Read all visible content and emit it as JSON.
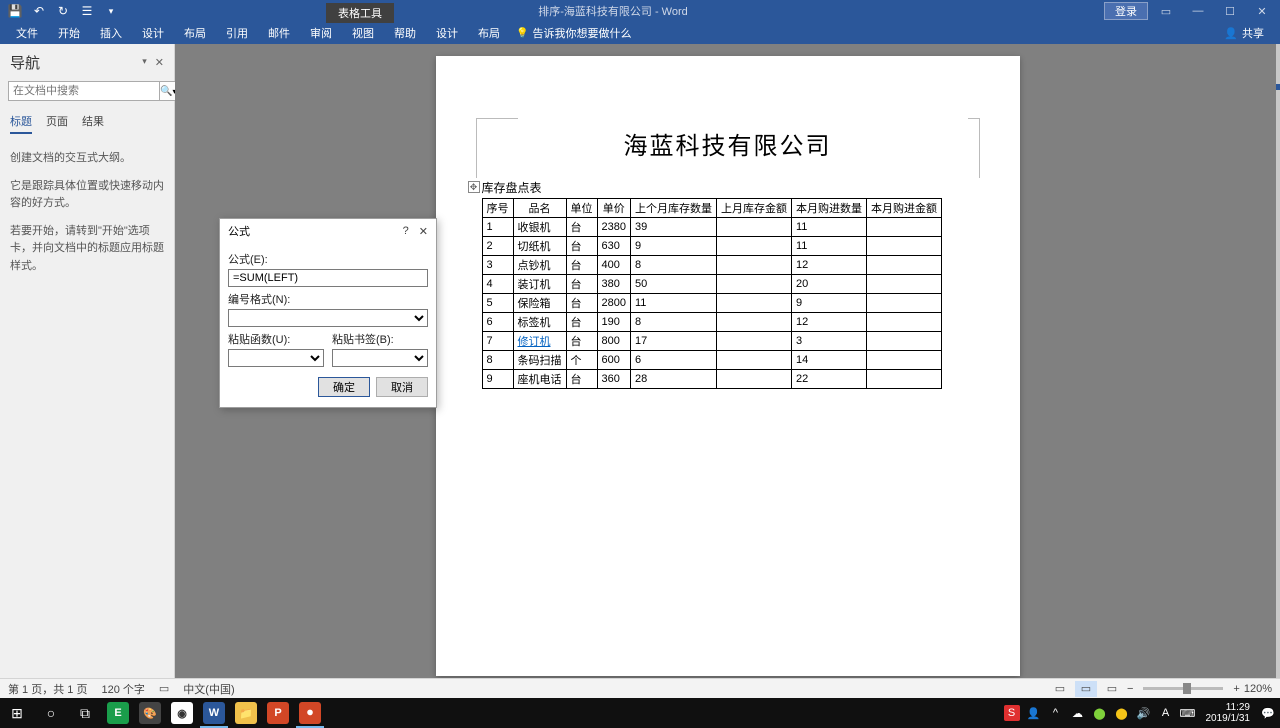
{
  "titlebar": {
    "context_tab": "表格工具",
    "doc_title": "排序-海蓝科技有限公司 - Word",
    "login": "登录"
  },
  "ribbon": {
    "tabs": [
      "文件",
      "开始",
      "插入",
      "设计",
      "布局",
      "引用",
      "邮件",
      "审阅",
      "视图",
      "帮助",
      "设计",
      "布局"
    ],
    "tell_me": "告诉我你想要做什么",
    "share": "共享"
  },
  "nav": {
    "title": "导航",
    "search_placeholder": "在文档中搜索",
    "tabs": [
      "标题",
      "页面",
      "结果"
    ],
    "body": {
      "p1": "创建文档的交互式大纲。",
      "p2": "它是跟踪具体位置或快速移动内容的好方式。",
      "p3": "若要开始，请转到\"开始\"选项卡，并向文档中的标题应用标题样式。"
    }
  },
  "document": {
    "heading": "海蓝科技有限公司",
    "subtitle": "库存盘点表",
    "headers": [
      "序号",
      "品名",
      "单位",
      "单价",
      "上个月库存数量",
      "上月库存金额",
      "本月购进数量",
      "本月购进金额"
    ],
    "rows": [
      {
        "idx": "1",
        "name": "收银机",
        "unit": "台",
        "price": "2380",
        "qty": "39",
        "amt": "",
        "in": "11",
        "inamt": ""
      },
      {
        "idx": "2",
        "name": "切纸机",
        "unit": "台",
        "price": "630",
        "qty": "9",
        "amt": "",
        "in": "11",
        "inamt": ""
      },
      {
        "idx": "3",
        "name": "点钞机",
        "unit": "台",
        "price": "400",
        "qty": "8",
        "amt": "",
        "in": "12",
        "inamt": ""
      },
      {
        "idx": "4",
        "name": "装订机",
        "unit": "台",
        "price": "380",
        "qty": "50",
        "amt": "",
        "in": "20",
        "inamt": ""
      },
      {
        "idx": "5",
        "name": "保险箱",
        "unit": "台",
        "price": "2800",
        "qty": "11",
        "amt": "",
        "in": "9",
        "inamt": ""
      },
      {
        "idx": "6",
        "name": "标签机",
        "unit": "台",
        "price": "190",
        "qty": "8",
        "amt": "",
        "in": "12",
        "inamt": ""
      },
      {
        "idx": "7",
        "name": "修订机",
        "unit": "台",
        "price": "800",
        "qty": "17",
        "amt": "",
        "in": "3",
        "inamt": "",
        "link": true
      },
      {
        "idx": "8",
        "name": "条码扫描",
        "unit": "个",
        "price": "600",
        "qty": "6",
        "amt": "",
        "in": "14",
        "inamt": ""
      },
      {
        "idx": "9",
        "name": "座机电话",
        "unit": "台",
        "price": "360",
        "qty": "28",
        "amt": "",
        "in": "22",
        "inamt": ""
      }
    ]
  },
  "dialog": {
    "title": "公式",
    "formula_label": "公式(E):",
    "formula_value": "=SUM(LEFT)",
    "number_format_label": "编号格式(N):",
    "paste_func_label": "粘贴函数(U):",
    "paste_bookmark_label": "粘贴书签(B):",
    "ok": "确定",
    "cancel": "取消"
  },
  "status": {
    "page": "第 1 页，共 1 页",
    "words": "120 个字",
    "lang": "中文(中国)",
    "zoom": "120%"
  },
  "taskbar": {
    "time": "11:29",
    "date": "2019/1/31"
  }
}
